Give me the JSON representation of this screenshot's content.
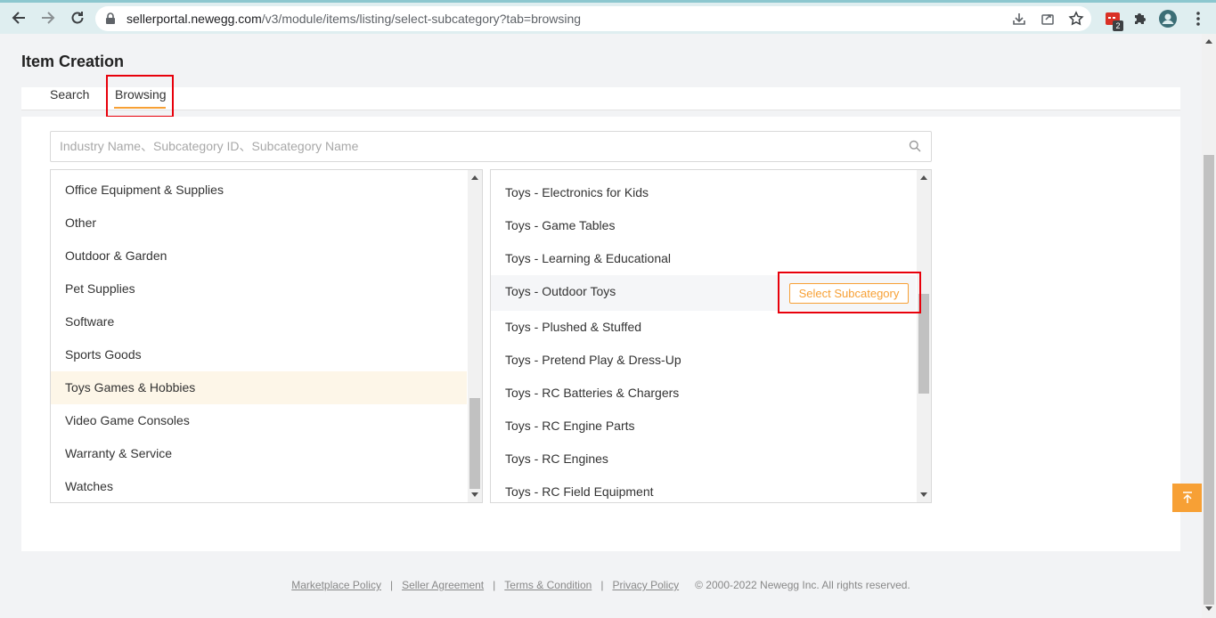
{
  "browser": {
    "url_host": "sellerportal.newegg.com",
    "url_path": "/v3/module/items/listing/select-subcategory?tab=browsing",
    "extension_badge": "2"
  },
  "page": {
    "title": "Item Creation"
  },
  "tabs": [
    {
      "label": "Search",
      "active": false
    },
    {
      "label": "Browsing",
      "active": true
    }
  ],
  "search": {
    "placeholder": "Industry Name、Subcategory ID、Subcategory Name",
    "value": ""
  },
  "industries": [
    {
      "label": "Office Equipment & Supplies"
    },
    {
      "label": "Other"
    },
    {
      "label": "Outdoor & Garden"
    },
    {
      "label": "Pet Supplies"
    },
    {
      "label": "Software"
    },
    {
      "label": "Sports Goods"
    },
    {
      "label": "Toys Games & Hobbies",
      "selected": true
    },
    {
      "label": "Video Game Consoles"
    },
    {
      "label": "Warranty & Service"
    },
    {
      "label": "Watches"
    }
  ],
  "subcategories": [
    {
      "label": "Toys - Electronics for Kids"
    },
    {
      "label": "Toys - Game Tables"
    },
    {
      "label": "Toys - Learning & Educational"
    },
    {
      "label": "Toys - Outdoor Toys",
      "hovered": true
    },
    {
      "label": "Toys - Plushed & Stuffed"
    },
    {
      "label": "Toys - Pretend Play & Dress-Up"
    },
    {
      "label": "Toys - RC Batteries & Chargers"
    },
    {
      "label": "Toys - RC Engine Parts"
    },
    {
      "label": "Toys - RC Engines"
    },
    {
      "label": "Toys - RC Field Equipment"
    }
  ],
  "select_button_label": "Select Subcategory",
  "footer": {
    "links": [
      "Marketplace Policy",
      "Seller Agreement",
      "Terms & Condition",
      "Privacy Policy"
    ],
    "separator": "|",
    "copyright": "© 2000-2022 Newegg Inc. All rights reserved."
  },
  "colors": {
    "accent": "#f7a035",
    "highlight_box": "#e8000b",
    "selected_row": "#fdf6e8"
  }
}
